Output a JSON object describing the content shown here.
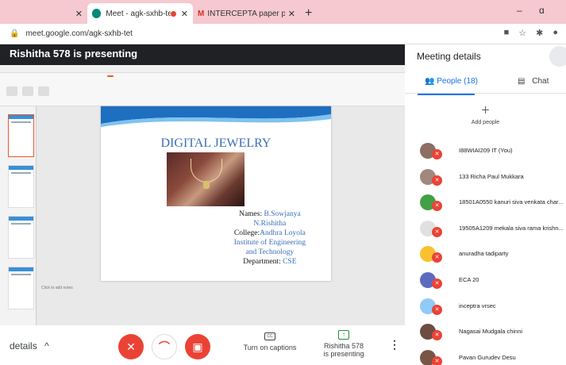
{
  "browser": {
    "tabs": [
      {
        "title": "",
        "active": false
      },
      {
        "title": "Meet - agk-sxhb-tet",
        "active": true,
        "favicon_color": "#00897b"
      },
      {
        "title": "INTERCEPTA paper presentation",
        "active": false
      }
    ],
    "new_tab": "+",
    "window_controls": {
      "minimize": "–",
      "maximize": "ɑ"
    },
    "url": "meet.google.com/agk-sxhb-tet"
  },
  "meet": {
    "presenting_title": "Rishitha 578 is presenting",
    "slide": {
      "headline": "DIGITAL JEWELRY",
      "names_label": "Names:",
      "name1": "B.Sowjanya",
      "name2": "N.Rishitha",
      "college_label": "College:",
      "college": "Andhra Loyola",
      "college2": "Institute of Engineering",
      "college3": "and Technology",
      "dept_label": "Department:",
      "dept": "CSE"
    },
    "notes_placeholder": "Click to add notes",
    "controls": {
      "details": "details",
      "captions": "Turn on captions",
      "presenter_line1": "Rishitha 578",
      "presenter_line2": "is presenting"
    }
  },
  "panel": {
    "title": "Meeting details",
    "people_tab": "People (18)",
    "chat_tab": "Chat",
    "add_people": "Add people",
    "participants": [
      {
        "name": "I88WIAI209 IT (You)",
        "color": "#8d6e63"
      },
      {
        "name": "133 Richa Paul Mukkara",
        "color": "#a1887f"
      },
      {
        "name": "18501A0550 kanuri siva venkata char...",
        "color": "#43a047"
      },
      {
        "name": "19505A1209 mekala siva rama krishn...",
        "color": "#e0e0e0"
      },
      {
        "name": "anuradha tadiparty",
        "color": "#fbc02d"
      },
      {
        "name": "ECA 20",
        "color": "#5c6bc0"
      },
      {
        "name": "inceptra vrsec",
        "color": "#90caf9"
      },
      {
        "name": "Nagasai Mudgala chinni",
        "color": "#6d4c41"
      },
      {
        "name": "Pavan Gurudev Desu",
        "color": "#795548"
      }
    ]
  }
}
